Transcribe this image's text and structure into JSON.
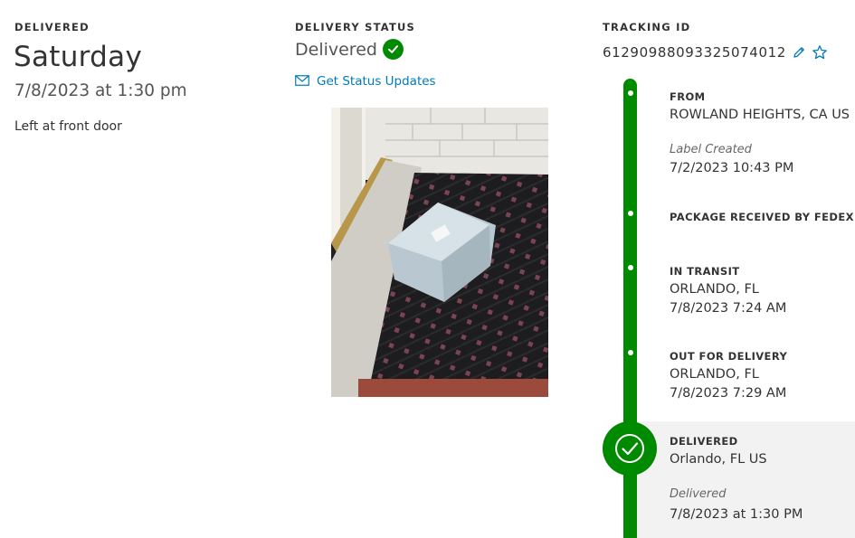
{
  "left": {
    "section_label": "DELIVERED",
    "day": "Saturday",
    "date_time": "7/8/2023 at 1:30 pm",
    "note": "Left at front door"
  },
  "middle": {
    "section_label": "DELIVERY STATUS",
    "status": "Delivered",
    "status_icon": "check-circle-icon",
    "status_color": "#008a00",
    "updates_link": "Get Status Updates",
    "updates_icon": "envelope-icon",
    "link_color": "#007ab7"
  },
  "right": {
    "section_label": "TRACKING ID",
    "tracking_id": "612909880933250740 12",
    "edit_icon": "pencil-icon",
    "favorite_icon": "star-icon"
  },
  "timeline": {
    "accent_color": "#008a00",
    "events": [
      {
        "title": "FROM",
        "location": "ROWLAND HEIGHTS, CA US",
        "sub": "Label Created",
        "time": "7/2/2023 10:43 PM"
      },
      {
        "title": "PACKAGE RECEIVED BY FEDEX"
      },
      {
        "title": "IN TRANSIT",
        "location": "ORLANDO, FL",
        "time": "7/8/2023 7:24 AM"
      },
      {
        "title": "OUT FOR DELIVERY",
        "location": "ORLANDO, FL",
        "time": "7/8/2023 7:29 AM"
      },
      {
        "title": "DELIVERED",
        "location": "Orlando, FL US",
        "sub": "Delivered",
        "time": "7/8/2023 at 1:30 PM",
        "icon": "check-circle-icon"
      }
    ]
  }
}
